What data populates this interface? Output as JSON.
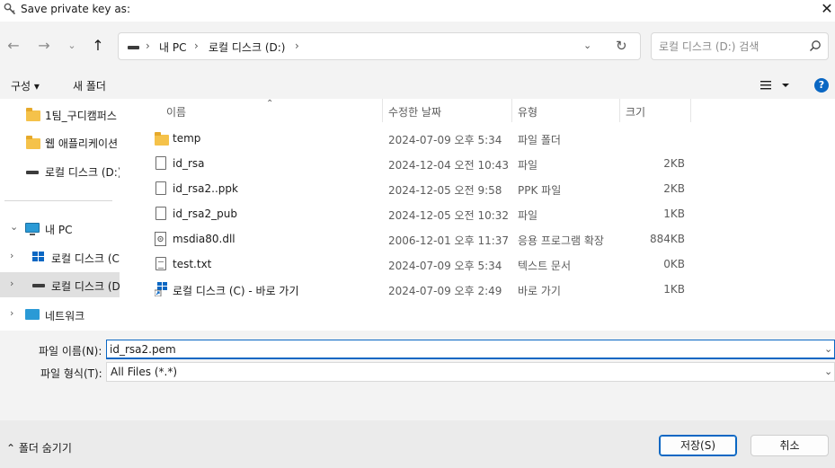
{
  "window": {
    "title": "Save private key as:"
  },
  "address": {
    "segments": [
      "내 PC",
      "로컬 디스크 (D:)"
    ]
  },
  "search": {
    "placeholder": "로컬 디스크 (D:) 검색"
  },
  "toolbar": {
    "organize": "구성 ▾",
    "new_folder": "새 폴더",
    "help": "?"
  },
  "sidebar": {
    "items": [
      {
        "label": "1팀_구디캠퍼스",
        "icon": "folder-icon"
      },
      {
        "label": "웹 애플리케이션",
        "icon": "folder-icon"
      },
      {
        "label": "로컬 디스크 (D:)",
        "icon": "drive-icon"
      },
      {
        "label": "내 PC",
        "icon": "pc-icon"
      },
      {
        "label": "로컬 디스크 (C:)",
        "icon": "windows-drive-icon"
      },
      {
        "label": "로컬 디스크 (D:)",
        "icon": "drive-icon"
      },
      {
        "label": "네트워크",
        "icon": "network-icon"
      }
    ]
  },
  "columns": {
    "name": "이름",
    "date": "수정한 날짜",
    "type": "유형",
    "size": "크기"
  },
  "files": [
    {
      "name": "temp",
      "date": "2024-07-09 오후 5:34",
      "type": "파일 폴더",
      "size": "",
      "icon": "folder-icon"
    },
    {
      "name": "id_rsa",
      "date": "2024-12-04 오전 10:43",
      "type": "파일",
      "size": "2KB",
      "icon": "file-icon"
    },
    {
      "name": "id_rsa2..ppk",
      "date": "2024-12-05 오전 9:58",
      "type": "PPK 파일",
      "size": "2KB",
      "icon": "file-icon"
    },
    {
      "name": "id_rsa2_pub",
      "date": "2024-12-05 오전 10:32",
      "type": "파일",
      "size": "1KB",
      "icon": "file-icon"
    },
    {
      "name": "msdia80.dll",
      "date": "2006-12-01 오후 11:37",
      "type": "응용 프로그램 확장",
      "size": "884KB",
      "icon": "dll-icon"
    },
    {
      "name": "test.txt",
      "date": "2024-07-09 오후 5:34",
      "type": "텍스트 문서",
      "size": "0KB",
      "icon": "text-file-icon"
    },
    {
      "name": "로컬 디스크 (C) - 바로 가기",
      "date": "2024-07-09 오후 2:49",
      "type": "바로 가기",
      "size": "1KB",
      "icon": "shortcut-icon"
    }
  ],
  "form": {
    "filename_label": "파일 이름(N):",
    "filename_value": "id_rsa2.pem",
    "filetype_label": "파일 형식(T):",
    "filetype_value": "All Files (*.*)"
  },
  "footer": {
    "hide_folders": "⌃  폴더 숨기기",
    "save": "저장(S)",
    "cancel": "취소"
  }
}
